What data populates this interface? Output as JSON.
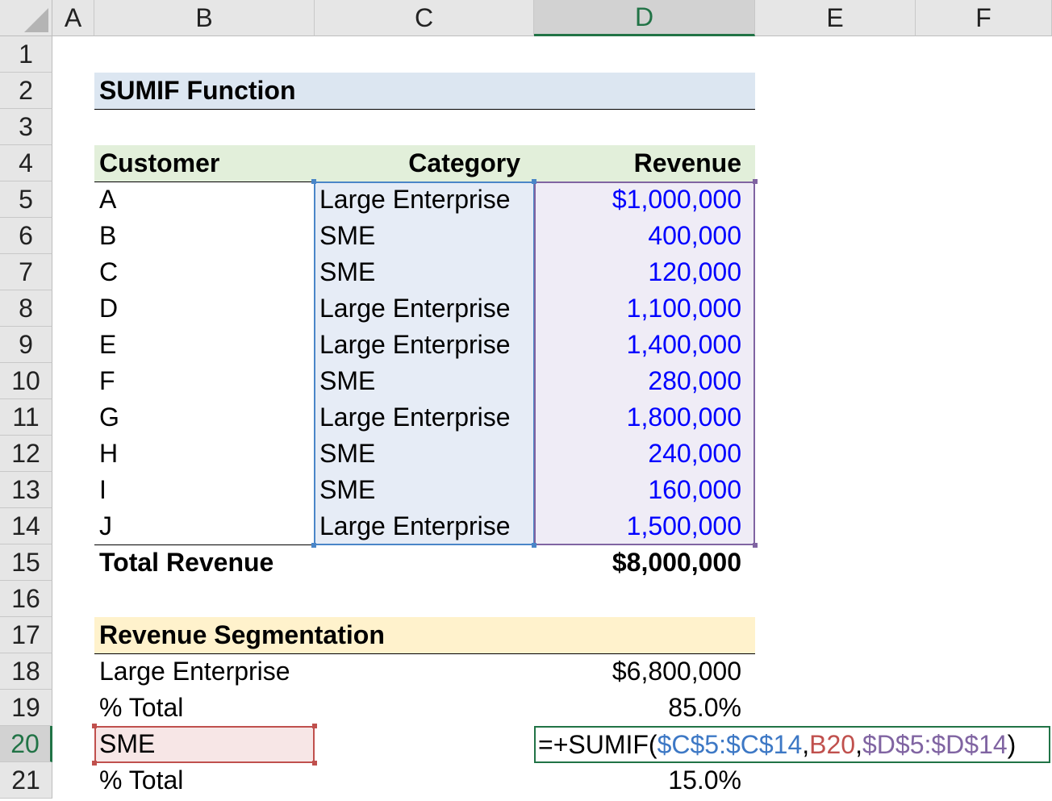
{
  "colors": {
    "accent": "#217346",
    "input_blue": "#0000ff",
    "ref_c": "#3d78c5",
    "ref_b": "#c0504d",
    "ref_d": "#8064a2",
    "title_band": "#dce6f1",
    "header_band": "#e2efda",
    "segmentation_band": "#fff2cc"
  },
  "columns": [
    "A",
    "B",
    "C",
    "D",
    "E",
    "F"
  ],
  "active_column": "D",
  "rows": [
    "1",
    "2",
    "3",
    "4",
    "5",
    "6",
    "7",
    "8",
    "9",
    "10",
    "11",
    "12",
    "13",
    "14",
    "15",
    "16",
    "17",
    "18",
    "19",
    "20",
    "21"
  ],
  "active_row": "20",
  "title": "SUMIF Function",
  "table": {
    "headers": [
      "Customer",
      "Category",
      "Revenue"
    ],
    "rows": [
      {
        "customer": "A",
        "category": "Large Enterprise",
        "revenue": "$1,000,000"
      },
      {
        "customer": "B",
        "category": "SME",
        "revenue": "400,000"
      },
      {
        "customer": "C",
        "category": "SME",
        "revenue": "120,000"
      },
      {
        "customer": "D",
        "category": "Large Enterprise",
        "revenue": "1,100,000"
      },
      {
        "customer": "E",
        "category": "Large Enterprise",
        "revenue": "1,400,000"
      },
      {
        "customer": "F",
        "category": "SME",
        "revenue": "280,000"
      },
      {
        "customer": "G",
        "category": "Large Enterprise",
        "revenue": "1,800,000"
      },
      {
        "customer": "H",
        "category": "SME",
        "revenue": "240,000"
      },
      {
        "customer": "I",
        "category": "SME",
        "revenue": "160,000"
      },
      {
        "customer": "J",
        "category": "Large Enterprise",
        "revenue": "1,500,000"
      }
    ],
    "total_label": "Total Revenue",
    "total_value": "$8,000,000"
  },
  "segmentation": {
    "title": "Revenue Segmentation",
    "large_label": "Large Enterprise",
    "large_value": "$6,800,000",
    "large_pct_label": "% Total",
    "large_pct": "85.0%",
    "sme_label": "SME",
    "sme_pct_label": "% Total",
    "sme_pct": "15.0%"
  },
  "formula": {
    "prefix": "=+SUMIF(",
    "arg1": "$C$5:$C$14",
    "sep1": ",",
    "arg2": "B20",
    "sep2": ",",
    "arg3": "$D$5:$D$14",
    "suffix": ")"
  }
}
